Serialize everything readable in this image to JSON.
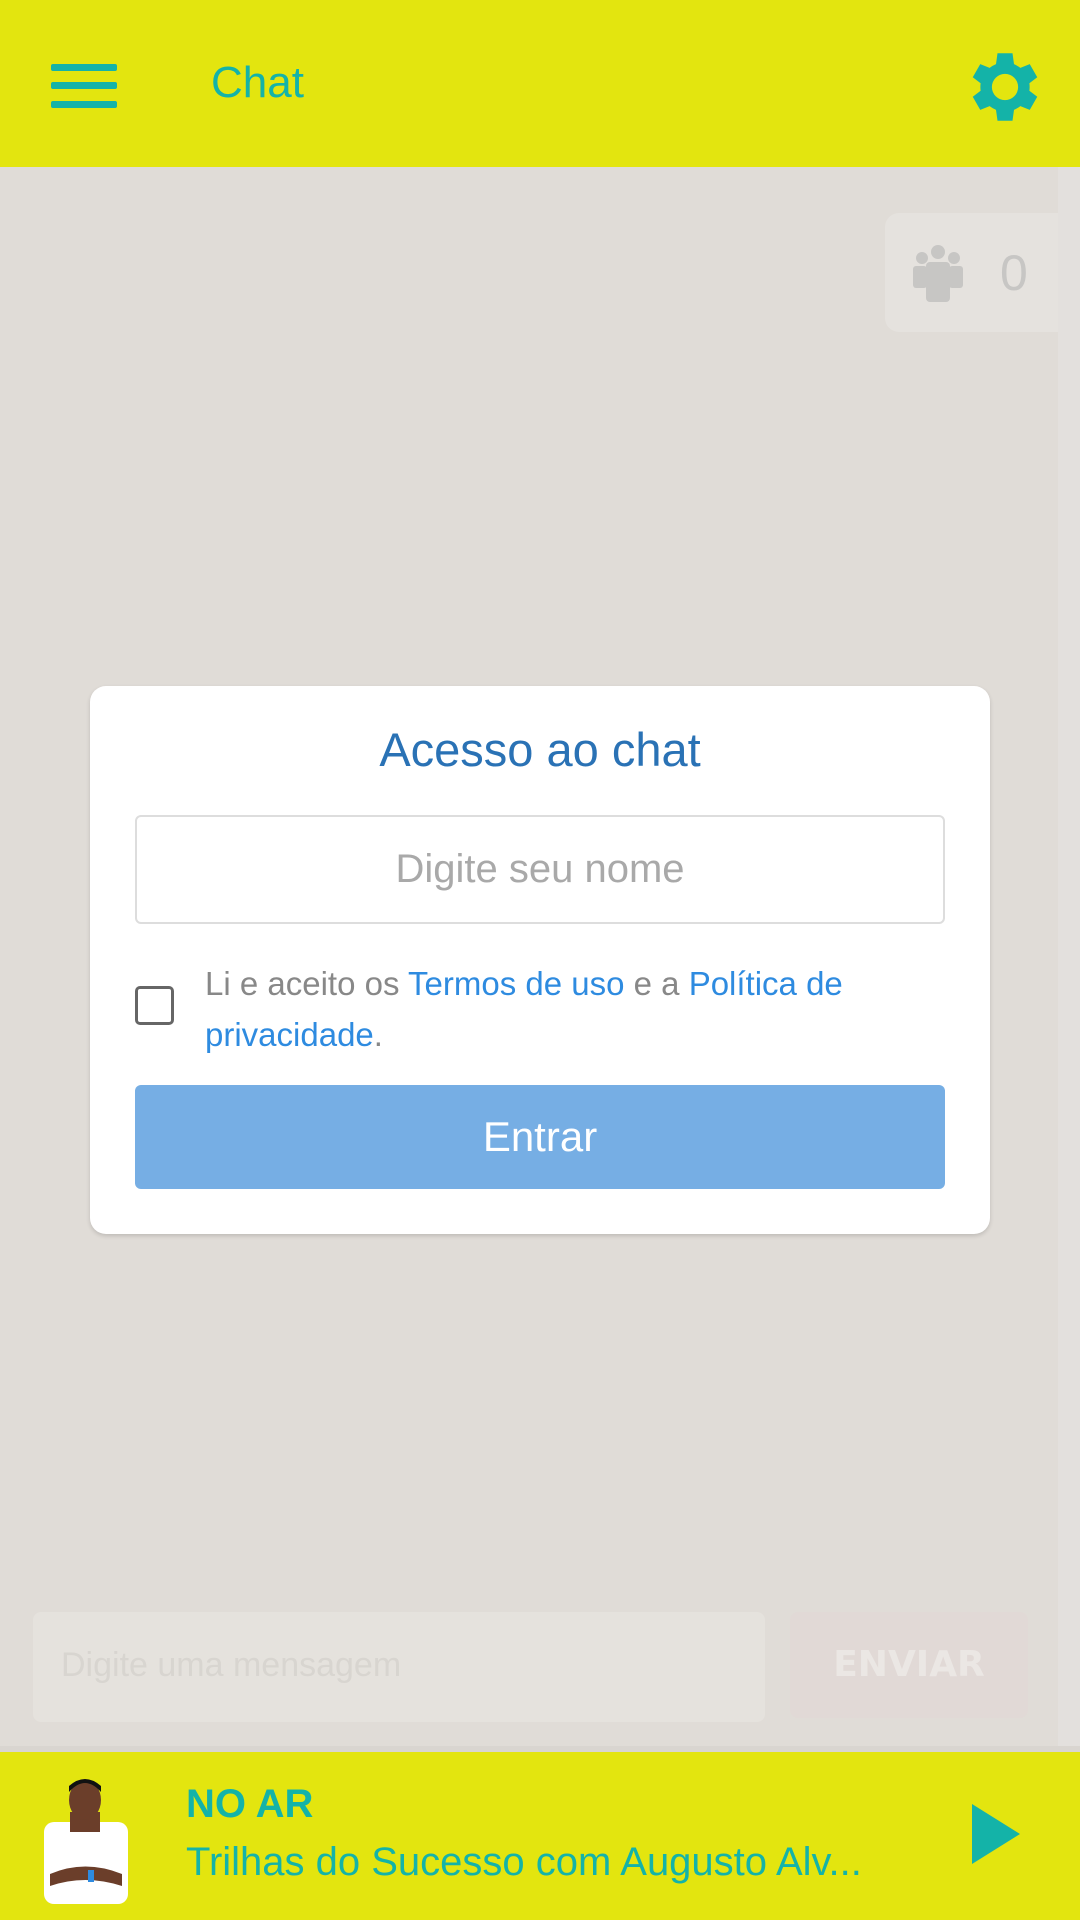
{
  "header": {
    "title": "Chat",
    "menu_icon": "hamburger-icon",
    "settings_icon": "gear-icon"
  },
  "users_online": {
    "icon": "users-icon",
    "count": "0"
  },
  "modal": {
    "title": "Acesso ao chat",
    "name_placeholder": "Digite seu nome",
    "checked": false,
    "terms_prefix": "Li e aceito os ",
    "terms_link": "Termos de uso",
    "terms_middle": " e a ",
    "privacy_link": "Política de privacidade",
    "terms_suffix": ".",
    "submit_label": "Entrar"
  },
  "composer": {
    "placeholder": "Digite uma mensagem",
    "send_label": "ENVIAR"
  },
  "player": {
    "status": "NO AR",
    "show": "Trilhas do Sucesso com Augusto Alv...",
    "play_icon": "play-icon"
  },
  "colors": {
    "brand_yellow": "#e3e50f",
    "accent_teal": "#14b3a8",
    "title_blue": "#2a72b5",
    "link_blue": "#2e8be0",
    "button_blue": "#76aee4"
  }
}
